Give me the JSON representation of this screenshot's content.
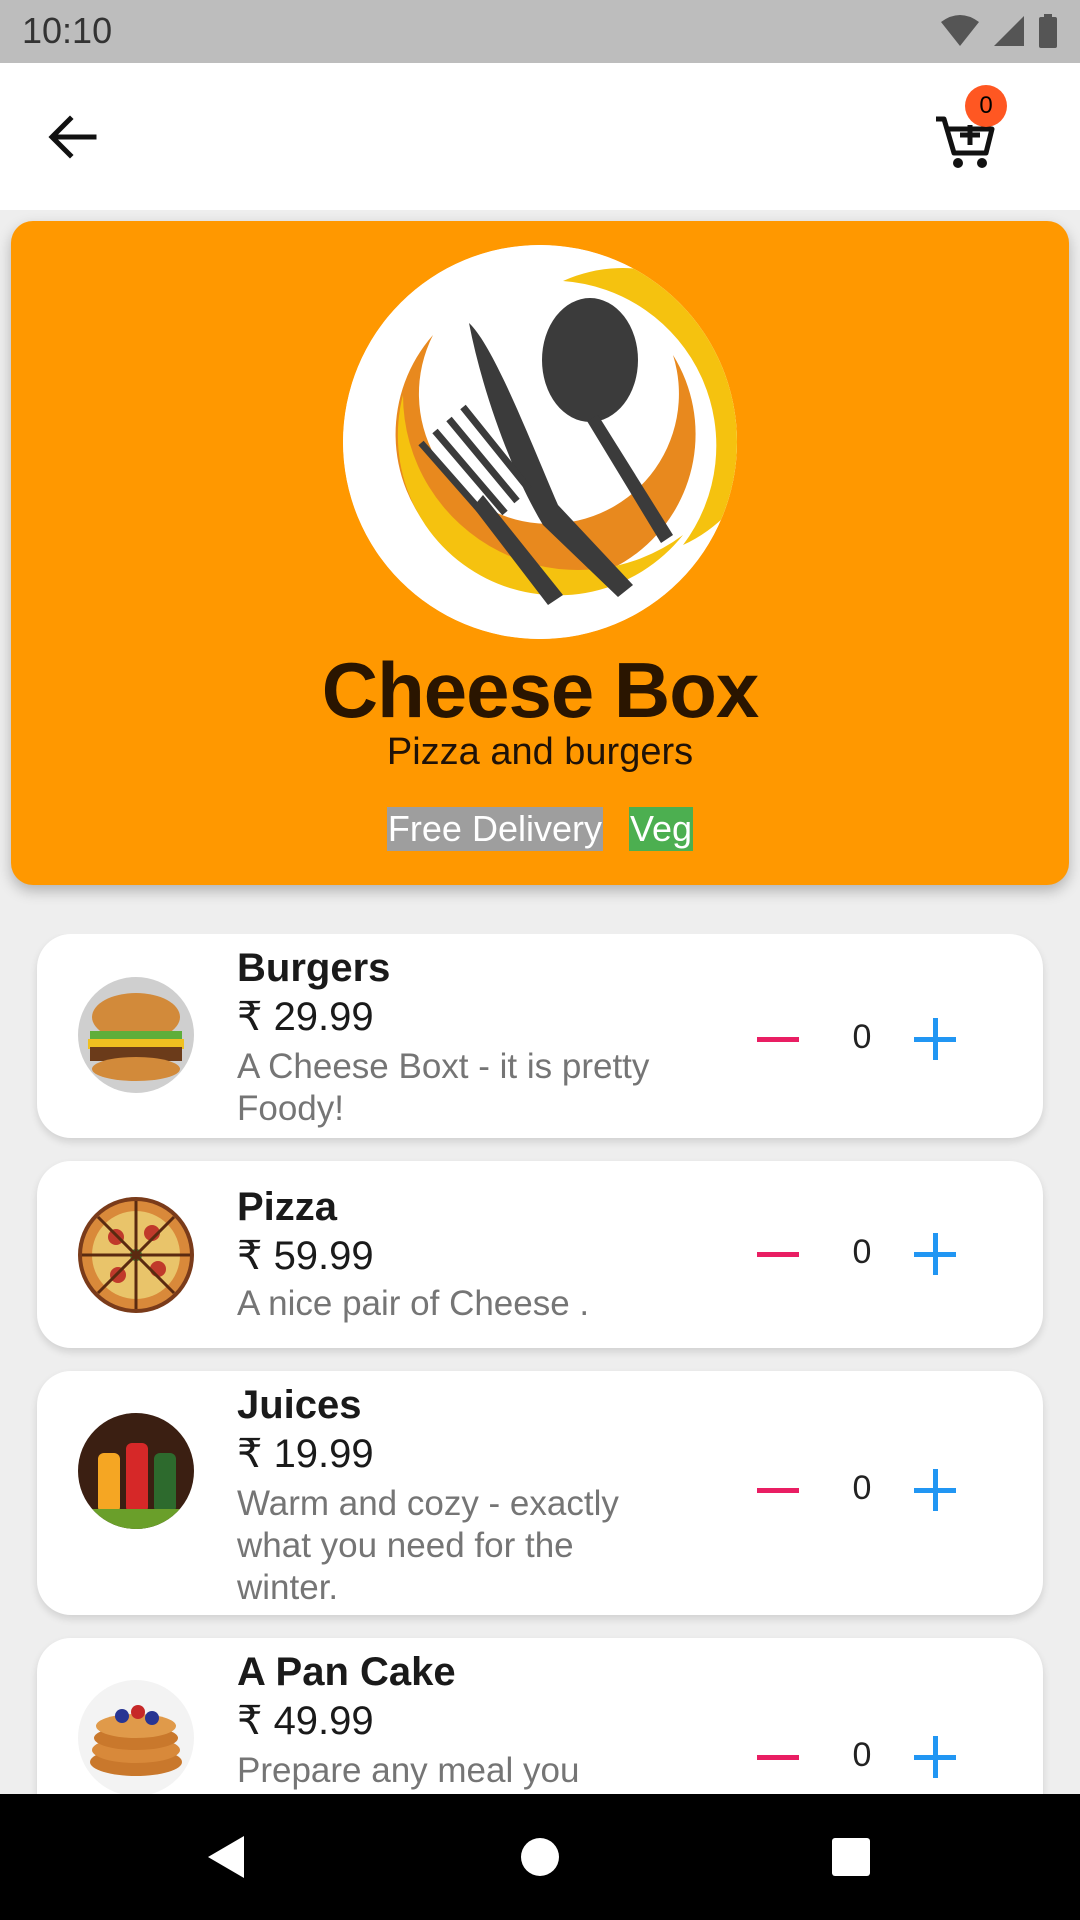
{
  "status_bar": {
    "time": "10:10"
  },
  "cart": {
    "count": "0"
  },
  "restaurant": {
    "name": "Cheese Box",
    "tagline": "Pizza and burgers",
    "tags": [
      "Free Delivery",
      "Veg"
    ]
  },
  "colors": {
    "header_bg": "#ff9800",
    "badge": "#ff5722",
    "minus": "#e91e63",
    "plus": "#2196f3",
    "tag_delivery": "#9e9e9e",
    "tag_veg": "#4caf50"
  },
  "menu": {
    "items": [
      {
        "name": "Burgers",
        "price": "₹ 29.99",
        "description": "A Cheese Boxt - it is pretty Foody!",
        "quantity": "0",
        "image": "burger-image"
      },
      {
        "name": "Pizza",
        "price": "₹ 59.99",
        "description": "A nice pair of Cheese .",
        "quantity": "0",
        "image": "pizza-image"
      },
      {
        "name": "Juices",
        "price": "₹ 19.99",
        "description": "Warm and cozy - exactly what you need for the winter.",
        "quantity": "0",
        "image": "juice-image"
      },
      {
        "name": "A Pan Cake",
        "price": "₹ 49.99",
        "description": "Prepare any meal you",
        "quantity": "0",
        "image": "pancake-image"
      }
    ]
  },
  "icons": {
    "back": "arrow-back-icon",
    "cart": "cart-icon",
    "minus": "minus-icon",
    "plus": "plus-icon",
    "nav_back": "nav-back-icon",
    "nav_home": "nav-home-icon",
    "nav_recents": "nav-recents-icon"
  }
}
